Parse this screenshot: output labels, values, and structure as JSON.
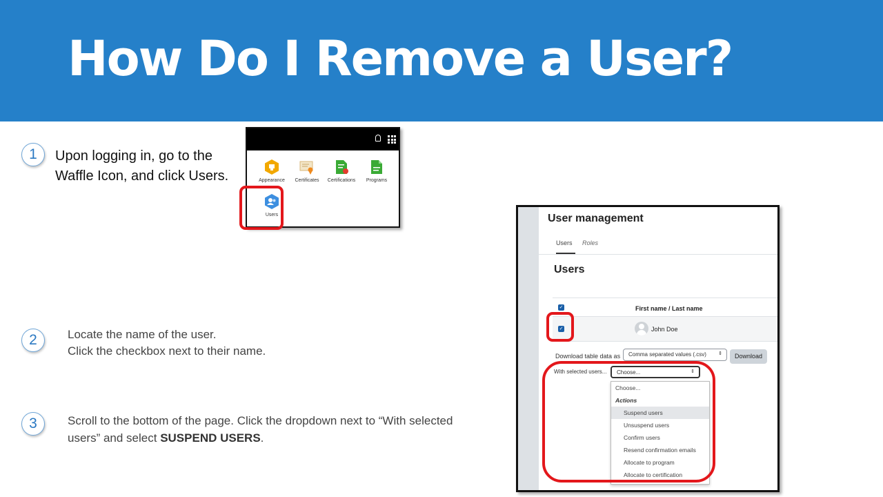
{
  "title": "How Do I Remove a User?",
  "steps": [
    {
      "number": "1",
      "text": "Upon logging in, go to the Waffle Icon, and click Users."
    },
    {
      "number": "2",
      "line1": "Locate the name of the user.",
      "line2": "Click the checkbox next to their name."
    },
    {
      "number": "3",
      "text_prefix": "Scroll to the bottom of the page. Click the dropdown next to “With selected users” and select ",
      "bold": "SUSPEND USERS",
      "text_suffix": "."
    }
  ],
  "waffle_menu": {
    "items": [
      {
        "label": "Appearance",
        "icon": "appearance-icon",
        "color": "#f2a800"
      },
      {
        "label": "Certificates",
        "icon": "certificate-icon",
        "color": "#e8c88a"
      },
      {
        "label": "Certifications",
        "icon": "certification-icon",
        "color": "#3aaa35"
      },
      {
        "label": "Programs",
        "icon": "program-icon",
        "color": "#3aaa35"
      },
      {
        "label": "Users",
        "icon": "users-icon",
        "color": "#3d8fe0"
      }
    ]
  },
  "user_management": {
    "title": "User management",
    "tabs": [
      "Users",
      "Roles"
    ],
    "heading": "Users",
    "column_header": "First name / Last name",
    "user_name": "John Doe",
    "download_label": "Download table data as",
    "download_format": "Comma separated values (.csv)",
    "download_button": "Download",
    "with_selected_label": "With selected users...",
    "dropdown_value": "Choose...",
    "dropdown_options": {
      "choose": "Choose...",
      "group": "Actions",
      "actions": [
        "Suspend users",
        "Unsuspend users",
        "Confirm users",
        "Resend confirmation emails",
        "Allocate to program",
        "Allocate to certification"
      ]
    }
  },
  "colors": {
    "banner": "#2580c9",
    "highlight": "#e3171b",
    "checkbox": "#1a5fa8"
  }
}
